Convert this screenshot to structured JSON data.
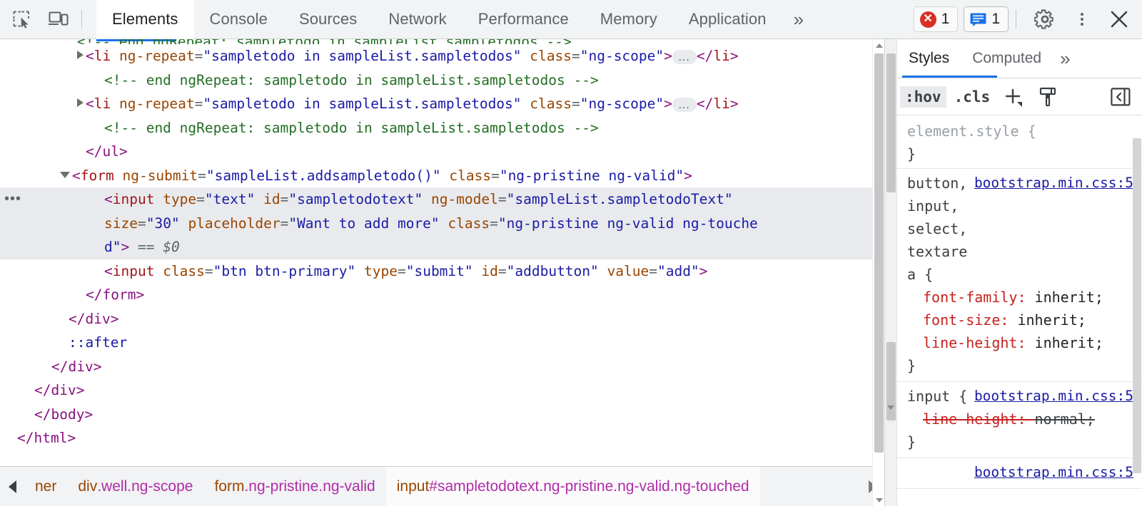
{
  "toolbar": {
    "inspect_icon": "inspect-element-icon",
    "device_icon": "device-toolbar-icon",
    "tabs": [
      {
        "label": "Elements",
        "active": true
      },
      {
        "label": "Console",
        "active": false
      },
      {
        "label": "Sources",
        "active": false
      },
      {
        "label": "Network",
        "active": false
      },
      {
        "label": "Performance",
        "active": false
      },
      {
        "label": "Memory",
        "active": false
      },
      {
        "label": "Application",
        "active": false
      }
    ],
    "more_tabs": "»",
    "error_count": "1",
    "message_count": "1",
    "settings_icon": "gear-icon",
    "menu_icon": "kebab-menu-icon",
    "close_icon": "close-icon"
  },
  "dom": {
    "lines": [
      {
        "id": "l0",
        "clipped": true,
        "indent": 108,
        "parts": [
          {
            "t": "cmt",
            "v": "<!-- end ngRepeat: sampletodo in sampleList.sampletodos -->"
          }
        ]
      },
      {
        "id": "l1",
        "indent": 108,
        "twisty": "closed",
        "parts": [
          {
            "t": "punc",
            "v": "<"
          },
          {
            "t": "tagname",
            "v": "li"
          },
          {
            "t": "plain",
            "v": " "
          },
          {
            "t": "attr",
            "v": "ng-repeat"
          },
          {
            "t": "eq",
            "v": "="
          },
          {
            "t": "val",
            "v": "\"sampletodo in sampleList.sampletodos\""
          },
          {
            "t": "plain",
            "v": " "
          },
          {
            "t": "attr",
            "v": "class"
          },
          {
            "t": "eq",
            "v": "="
          },
          {
            "t": "val",
            "v": "\"ng-scope\""
          },
          {
            "t": "punc",
            "v": ">"
          },
          {
            "t": "ellipsis",
            "v": "…"
          },
          {
            "t": "punc",
            "v": "</"
          },
          {
            "t": "tagname",
            "v": "li"
          },
          {
            "t": "punc",
            "v": ">"
          }
        ]
      },
      {
        "id": "l2",
        "indent": 134,
        "parts": [
          {
            "t": "cmt",
            "v": "<!-- end ngRepeat: sampletodo in sampleList.sampletodos -->"
          }
        ]
      },
      {
        "id": "l3",
        "indent": 108,
        "twisty": "closed",
        "parts": [
          {
            "t": "punc",
            "v": "<"
          },
          {
            "t": "tagname",
            "v": "li"
          },
          {
            "t": "plain",
            "v": " "
          },
          {
            "t": "attr",
            "v": "ng-repeat"
          },
          {
            "t": "eq",
            "v": "="
          },
          {
            "t": "val",
            "v": "\"sampletodo in sampleList.sampletodos\""
          },
          {
            "t": "plain",
            "v": " "
          },
          {
            "t": "attr",
            "v": "class"
          },
          {
            "t": "eq",
            "v": "="
          },
          {
            "t": "val",
            "v": "\"ng-scope\""
          },
          {
            "t": "punc",
            "v": ">"
          },
          {
            "t": "ellipsis",
            "v": "…"
          },
          {
            "t": "punc",
            "v": "</"
          },
          {
            "t": "tagname",
            "v": "li"
          },
          {
            "t": "punc",
            "v": ">"
          }
        ]
      },
      {
        "id": "l4",
        "indent": 134,
        "parts": [
          {
            "t": "cmt",
            "v": "<!-- end ngRepeat: sampletodo in sampleList.sampletodos -->"
          }
        ]
      },
      {
        "id": "l5",
        "indent": 108,
        "parts": [
          {
            "t": "punc",
            "v": "</"
          },
          {
            "t": "tagname2",
            "v": "ul"
          },
          {
            "t": "punc",
            "v": ">"
          }
        ]
      },
      {
        "id": "l6",
        "indent": 84,
        "twisty": "open",
        "parts": [
          {
            "t": "punc",
            "v": "<"
          },
          {
            "t": "tagname",
            "v": "form"
          },
          {
            "t": "plain",
            "v": " "
          },
          {
            "t": "attr",
            "v": "ng-submit"
          },
          {
            "t": "eq",
            "v": "="
          },
          {
            "t": "val",
            "v": "\"sampleList.addsampletodo()\""
          },
          {
            "t": "plain",
            "v": " "
          },
          {
            "t": "attr",
            "v": "class"
          },
          {
            "t": "eq",
            "v": "="
          },
          {
            "t": "val",
            "v": "\"ng-pristine ng-valid\""
          },
          {
            "t": "punc",
            "v": ">"
          }
        ]
      },
      {
        "id": "l7",
        "indent": 134,
        "selected": true,
        "gutter": "•••",
        "parts": [
          {
            "t": "punc",
            "v": "<"
          },
          {
            "t": "tagname",
            "v": "input"
          },
          {
            "t": "plain",
            "v": " "
          },
          {
            "t": "attr",
            "v": "type"
          },
          {
            "t": "eq",
            "v": "="
          },
          {
            "t": "val",
            "v": "\"text\""
          },
          {
            "t": "plain",
            "v": " "
          },
          {
            "t": "attr",
            "v": "id"
          },
          {
            "t": "eq",
            "v": "="
          },
          {
            "t": "val",
            "v": "\"sampletodotext\""
          },
          {
            "t": "plain",
            "v": " "
          },
          {
            "t": "attr",
            "v": "ng-model"
          },
          {
            "t": "eq",
            "v": "="
          },
          {
            "t": "val",
            "v": "\"sampleList.sampletodoText\""
          }
        ]
      },
      {
        "id": "l8",
        "indent": 134,
        "selected": true,
        "parts": [
          {
            "t": "attr",
            "v": "size"
          },
          {
            "t": "eq",
            "v": "="
          },
          {
            "t": "val",
            "v": "\"30\""
          },
          {
            "t": "plain",
            "v": " "
          },
          {
            "t": "attr",
            "v": "placeholder"
          },
          {
            "t": "eq",
            "v": "="
          },
          {
            "t": "val",
            "v": "\"Want to add more\""
          },
          {
            "t": "plain",
            "v": " "
          },
          {
            "t": "attr",
            "v": "class"
          },
          {
            "t": "eq",
            "v": "="
          },
          {
            "t": "val",
            "v": "\"ng-pristine ng-valid ng-touche"
          }
        ]
      },
      {
        "id": "l9",
        "indent": 134,
        "selected": true,
        "parts": [
          {
            "t": "val",
            "v": "d\""
          },
          {
            "t": "punc",
            "v": ">"
          },
          {
            "t": "plain",
            "v": " "
          },
          {
            "t": "dollar",
            "v": "== $0"
          }
        ]
      },
      {
        "id": "l10",
        "indent": 134,
        "parts": [
          {
            "t": "punc",
            "v": "<"
          },
          {
            "t": "tagname",
            "v": "input"
          },
          {
            "t": "plain",
            "v": " "
          },
          {
            "t": "attr",
            "v": "class"
          },
          {
            "t": "eq",
            "v": "="
          },
          {
            "t": "val",
            "v": "\"btn btn-primary\""
          },
          {
            "t": "plain",
            "v": " "
          },
          {
            "t": "attr",
            "v": "type"
          },
          {
            "t": "eq",
            "v": "="
          },
          {
            "t": "val",
            "v": "\"submit\""
          },
          {
            "t": "plain",
            "v": " "
          },
          {
            "t": "attr",
            "v": "id"
          },
          {
            "t": "eq",
            "v": "="
          },
          {
            "t": "val",
            "v": "\"addbutton\""
          },
          {
            "t": "plain",
            "v": " "
          },
          {
            "t": "attr",
            "v": "value"
          },
          {
            "t": "eq",
            "v": "="
          },
          {
            "t": "val",
            "v": "\"add\""
          },
          {
            "t": "punc",
            "v": ">"
          }
        ]
      },
      {
        "id": "l11",
        "indent": 108,
        "parts": [
          {
            "t": "punc",
            "v": "</"
          },
          {
            "t": "tagname2",
            "v": "form"
          },
          {
            "t": "punc",
            "v": ">"
          }
        ]
      },
      {
        "id": "l12",
        "indent": 84,
        "parts": [
          {
            "t": "punc",
            "v": "</"
          },
          {
            "t": "tagname2",
            "v": "div"
          },
          {
            "t": "punc",
            "v": ">"
          }
        ]
      },
      {
        "id": "l13",
        "indent": 84,
        "parts": [
          {
            "t": "pseudo",
            "v": "::after"
          }
        ]
      },
      {
        "id": "l14",
        "indent": 60,
        "parts": [
          {
            "t": "punc",
            "v": "</"
          },
          {
            "t": "tagname2",
            "v": "div"
          },
          {
            "t": "punc",
            "v": ">"
          }
        ]
      },
      {
        "id": "l15",
        "indent": 36,
        "parts": [
          {
            "t": "punc",
            "v": "</"
          },
          {
            "t": "tagname2",
            "v": "div"
          },
          {
            "t": "punc",
            "v": ">"
          }
        ]
      },
      {
        "id": "l16",
        "indent": 36,
        "parts": [
          {
            "t": "punc",
            "v": "</"
          },
          {
            "t": "tagname2",
            "v": "body"
          },
          {
            "t": "punc",
            "v": ">"
          }
        ]
      },
      {
        "id": "l17",
        "indent": 12,
        "parts": [
          {
            "t": "punc",
            "v": "</"
          },
          {
            "t": "tagname2",
            "v": "html"
          },
          {
            "t": "punc",
            "v": ">"
          }
        ]
      }
    ]
  },
  "breadcrumb": {
    "items": [
      {
        "id": "c0",
        "selected": false,
        "parts": [
          {
            "t": "tag",
            "v": "ner"
          }
        ]
      },
      {
        "id": "c1",
        "selected": false,
        "parts": [
          {
            "t": "tag",
            "v": "div"
          },
          {
            "t": "cls",
            "v": ".well"
          },
          {
            "t": "cls",
            "v": ".ng-scope"
          }
        ]
      },
      {
        "id": "c2",
        "selected": false,
        "parts": [
          {
            "t": "tag",
            "v": "form"
          },
          {
            "t": "cls",
            "v": ".ng-pristine"
          },
          {
            "t": "cls",
            "v": ".ng-valid"
          }
        ]
      },
      {
        "id": "c3",
        "selected": true,
        "parts": [
          {
            "t": "tag",
            "v": "input"
          },
          {
            "t": "id",
            "v": "#sampletodotext"
          },
          {
            "t": "cls2",
            "v": ".ng-pristine"
          },
          {
            "t": "cls2",
            "v": ".ng-valid"
          },
          {
            "t": "cls2",
            "v": ".ng-touched"
          }
        ]
      }
    ]
  },
  "styles": {
    "tabs": [
      {
        "label": "Styles",
        "active": true
      },
      {
        "label": "Computed",
        "active": false
      }
    ],
    "more": "»",
    "toolbar": {
      "hov": ":hov",
      "cls": ".cls",
      "new_rule_icon": "plus-new-style-rule-icon",
      "class_filter_icon": "paintbrush-icon",
      "toggle_pane_icon": "toggle-sidebar-icon"
    },
    "element_style": {
      "selector": "element.style {",
      "close": "}"
    },
    "rules": [
      {
        "id": "r1",
        "selector": "button, input, select, textarea {",
        "source": "bootstrap.min.css:5",
        "declarations": [
          {
            "prop": "font-family",
            "value": "inherit;",
            "overridden": false
          },
          {
            "prop": "font-size",
            "value": "inherit;",
            "overridden": false
          },
          {
            "prop": "line-height",
            "value": "inherit;",
            "overridden": false
          }
        ],
        "close": "}"
      },
      {
        "id": "r2",
        "selector": "input {",
        "source": "bootstrap.min.css:5",
        "declarations": [
          {
            "prop": "line-height",
            "value": "normal;",
            "overridden": true
          }
        ],
        "close": "}"
      },
      {
        "id": "r3",
        "selector": "",
        "source": "bootstrap.min.css:5",
        "declarations": [],
        "close": ""
      }
    ]
  },
  "colors": {
    "accent": "#1a73e8",
    "error": "#d93025",
    "message": "#1a73e8",
    "tag": "#881280",
    "attr_name": "#994500",
    "attr_value": "#1a1aa6",
    "comment": "#236e25",
    "selection": "#e8eaed",
    "css_property": "#c5221f"
  }
}
